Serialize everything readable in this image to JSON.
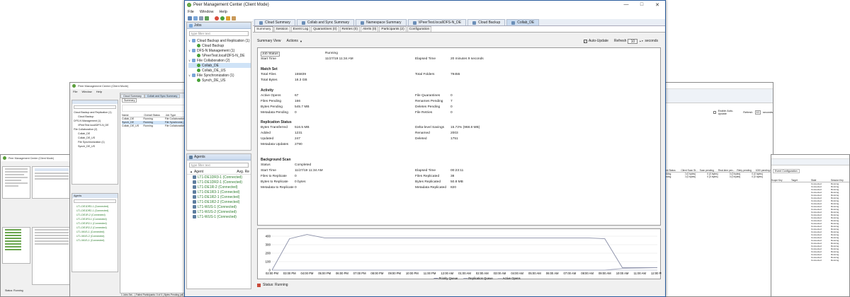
{
  "main": {
    "title": "Peer Management Center (Client Mode)",
    "menu": [
      "File",
      "Window",
      "Help"
    ],
    "window_controls": [
      "—",
      "□",
      "✕"
    ],
    "jobs_panel": {
      "label": "Jobs",
      "filter_placeholder": "type filter text",
      "tree": [
        {
          "label": "Cloud Backup and Replication (1)",
          "level": 0,
          "kind": "folder"
        },
        {
          "label": "Cloud Backup",
          "level": 1,
          "kind": "job"
        },
        {
          "label": "DFS-N Management (1)",
          "level": 0,
          "kind": "folder"
        },
        {
          "label": "\\\\PeerTest.local\\DFS-N_DE",
          "level": 1,
          "kind": "job"
        },
        {
          "label": "File Collaboration (2)",
          "level": 0,
          "kind": "folder"
        },
        {
          "label": "Collab_DE",
          "level": 1,
          "kind": "job",
          "selected": true
        },
        {
          "label": "Collab_DE_US",
          "level": 1,
          "kind": "job"
        },
        {
          "label": "File Synchronization (1)",
          "level": 0,
          "kind": "folder"
        },
        {
          "label": "Synch_DE_US",
          "level": 1,
          "kind": "job"
        }
      ]
    },
    "agents_panel": {
      "label": "Agents",
      "filter_placeholder": "type filter text",
      "col_agent": "Agent",
      "col_avg": "Avg. Re",
      "agents": [
        "LT1-DE1DR3-1 (Connected)",
        "LT1-DE1DR2-1 (Connected)",
        "LT1-DE1R-2 (Connected)",
        "LT1-DE1R3-1 (Connected)",
        "LT1-DE1R2-1 (Connected)",
        "LT1-DE1R2-2 (Connected)",
        "LT1-WUS-1 (Connected)",
        "LT1-WUS-2 (Connected)",
        "LT1-WUS-1 (Connected)"
      ]
    },
    "tabs": [
      "Cloud Summary",
      "Collab and Sync Summary",
      "Namespace Summary",
      "\\\\PeerTest.local\\DFS-N_DE",
      "Cloud Backup",
      "Collab_DE"
    ],
    "subtabs": [
      "Summary",
      "Session",
      "Event Log",
      "Quarantines (0)",
      "Retries (0)",
      "Alerts (0)",
      "Participants (2)",
      "Configuration"
    ],
    "summary_view_label": "Summary View",
    "actions_label": "Actions",
    "auto_update_label": "Auto-Update",
    "refresh_label": "Refresh",
    "refresh_value": "10",
    "seconds_label": "seconds",
    "job_status": {
      "label": "Job Status",
      "value": "Running"
    },
    "start_time": {
      "label": "Start Time",
      "value": "11/27/19 11:34 AM"
    },
    "elapsed_time": {
      "label": "Elapsed Time",
      "value": "20 minutes 9 seconds"
    },
    "match_set": {
      "title": "Match Set",
      "total_files_label": "Total Files",
      "total_files": "155839",
      "total_folders_label": "Total Folders",
      "total_folders": "79455",
      "total_bytes_label": "Total Bytes",
      "total_bytes": "18.3 GB"
    },
    "activity": {
      "title": "Activity",
      "left": [
        {
          "label": "Active Opens",
          "value": "67"
        },
        {
          "label": "Files Pending",
          "value": "166"
        },
        {
          "label": "Bytes Pending",
          "value": "545.7 MB"
        },
        {
          "label": "Metadata Pending",
          "value": "0"
        }
      ],
      "right": [
        {
          "label": "File Quarantines",
          "value": "0"
        },
        {
          "label": "Renames Pending",
          "value": "7"
        },
        {
          "label": "Deletes Pending",
          "value": "0"
        },
        {
          "label": "File Retries",
          "value": "0"
        }
      ]
    },
    "replication": {
      "title": "Replication Status",
      "left": [
        {
          "label": "Bytes Transferred",
          "value": "516.5 MB"
        },
        {
          "label": "Added",
          "value": "1231"
        },
        {
          "label": "Updated",
          "value": "247"
        },
        {
          "label": "Metadata Updates",
          "value": "2790"
        }
      ],
      "right": [
        {
          "label": "Delta-level Savings",
          "value": "15.72% (968.8 MB)"
        },
        {
          "label": "Renamed",
          "value": "2003"
        },
        {
          "label": "Deleted",
          "value": "1751"
        }
      ]
    },
    "background_scan": {
      "title": "Background Scan",
      "status_label": "Status",
      "status": "Completed",
      "left": [
        {
          "label": "Start Time",
          "value": "11/27/19 11:34 AM"
        },
        {
          "label": "Files to Replicate",
          "value": "0"
        },
        {
          "label": "Bytes to Replicate",
          "value": "0 bytes"
        },
        {
          "label": "Metadata to Replicate",
          "value": "0"
        }
      ],
      "right": [
        {
          "label": "Elapsed Time",
          "value": "00:23:11"
        },
        {
          "label": "Files Replicated",
          "value": "38"
        },
        {
          "label": "Bytes Replicated",
          "value": "50.8 MB"
        },
        {
          "label": "Metadata Replicated",
          "value": "820"
        }
      ]
    },
    "status_bar": "Status: Running"
  },
  "chart_data": {
    "type": "line",
    "x": [
      "02:00 PM",
      "03:00 PM",
      "04:00 PM",
      "05:00 PM",
      "06:00 PM",
      "07:00 PM",
      "08:00 PM",
      "09:00 PM",
      "10:00 PM",
      "11:00 PM",
      "12:00 AM",
      "01:00 AM",
      "02:00 AM",
      "03:00 AM",
      "04:00 AM",
      "05:00 AM",
      "06:00 AM",
      "07:00 AM",
      "08:00 AM",
      "09:00 AM",
      "10:00 AM",
      "11:00 AM",
      "12:00 PM"
    ],
    "yticks": [
      0,
      100,
      200,
      300,
      400
    ],
    "ylim": [
      0,
      450
    ],
    "series": [
      {
        "name": "Priority Queue",
        "color": "#8a8fa8",
        "values": [
          0,
          370,
          420,
          380,
          380,
          380,
          380,
          380,
          380,
          380,
          380,
          380,
          380,
          380,
          380,
          380,
          380,
          380,
          380,
          370,
          30,
          30,
          30
        ]
      },
      {
        "name": "Replication Queue",
        "color": "#a7abc0",
        "values": [
          0,
          0,
          0,
          0,
          0,
          0,
          0,
          0,
          0,
          0,
          0,
          0,
          0,
          0,
          0,
          0,
          0,
          0,
          0,
          0,
          20,
          25,
          30
        ]
      },
      {
        "name": "Active Opens",
        "color": "#c9ccd8",
        "values": [
          0,
          0,
          0,
          0,
          0,
          0,
          0,
          0,
          0,
          0,
          0,
          0,
          0,
          0,
          0,
          0,
          0,
          0,
          0,
          0,
          0,
          0,
          0
        ]
      }
    ]
  },
  "bg_left2": {
    "title": "Peer Management Center (Client Mode)",
    "menu": [
      "File",
      "Window",
      "Help"
    ],
    "tree": [
      "Cloud Backup and Replication (1)",
      "Cloud Backup",
      "DFS-N Management (1)",
      "\\\\PeerTest.local\\DFS-N_DE",
      "File Collaboration (2)",
      "Collab_DE",
      "Collab_DE_US",
      "File Synchronization (1)",
      "Synch_DE_US"
    ],
    "agents_label": "Agents",
    "agents": [
      "LT1-DE1DR3-1 (Connected)",
      "LT1-DE1DR2-1 (Connected)",
      "LT1-DE1R-2 (Connected)",
      "LT1-DE1R3-1 (Connected)",
      "LT1-DE1R2-1 (Connected)",
      "LT1-DE1R2-2 (Connected)",
      "LT1-WUS-1 (Connected)",
      "LT1-WUS-2 (Connected)",
      "LT1-WUS-1 (Connected)"
    ],
    "tabs": [
      "Cloud Summary",
      "Collab and Sync Summary"
    ],
    "summary_tab": "Summary",
    "table_headers": [
      "Name",
      "Overall Status",
      "Job Type"
    ],
    "table_rows": [
      [
        "Collab_DE",
        "Running",
        "File Collaboration"
      ],
      [
        "Synch_DE",
        "Running",
        "File Synchroniz..."
      ],
      [
        "Collab_DE_US",
        "Running",
        "File Collaboration"
      ]
    ],
    "footer": "1 Jobs Sel... | Failed Participants: 0 of 0 | Bytes Pending (all..."
  },
  "bg_left1": {
    "title": "Peer Management Center (Client Mode)",
    "footer": "Status: Running"
  },
  "bg_right1": {
    "auto_update": "Enable Auto-Update",
    "refresh": "Refresh",
    "refresh_value": "10",
    "seconds": "seconds",
    "cols": [
      "Client Status",
      "Client Scan St...",
      "Scan pending",
      "Real-time pen...",
      "Retry pending",
      "1000 pending fo..."
    ],
    "rows": [
      [
        "Running",
        "0 (0 bytes)",
        "0 (0 bytes)",
        "0 (0 bytes)",
        "0 (0 bytes)"
      ],
      [
        "Running",
        "0 (0 bytes)",
        "0 (0 bytes)",
        "0 (0 bytes)",
        "0 (0 bytes)"
      ]
    ]
  },
  "bg_right2": {
    "subtab": "Event Configuration",
    "cols": [
      "Scope Key",
      "Target",
      "State",
      "Session Key"
    ],
    "status_word": "Running",
    "state_word": "Connected"
  }
}
